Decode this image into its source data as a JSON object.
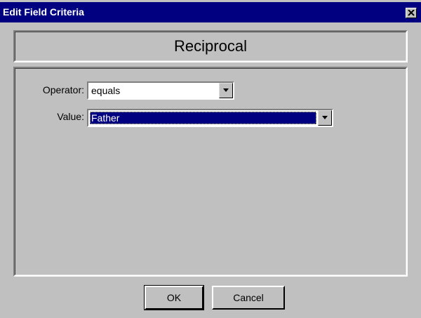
{
  "window": {
    "title": "Edit Field Criteria",
    "close_icon": "close-icon"
  },
  "header": {
    "title": "Reciprocal"
  },
  "form": {
    "operator": {
      "label": "Operator:",
      "value": "equals"
    },
    "value": {
      "label": "Value:",
      "value": "Father"
    }
  },
  "buttons": {
    "ok": "OK",
    "cancel": "Cancel"
  },
  "colors": {
    "titlebar": "#000080",
    "face": "#c0c0c0",
    "selection": "#000080"
  }
}
